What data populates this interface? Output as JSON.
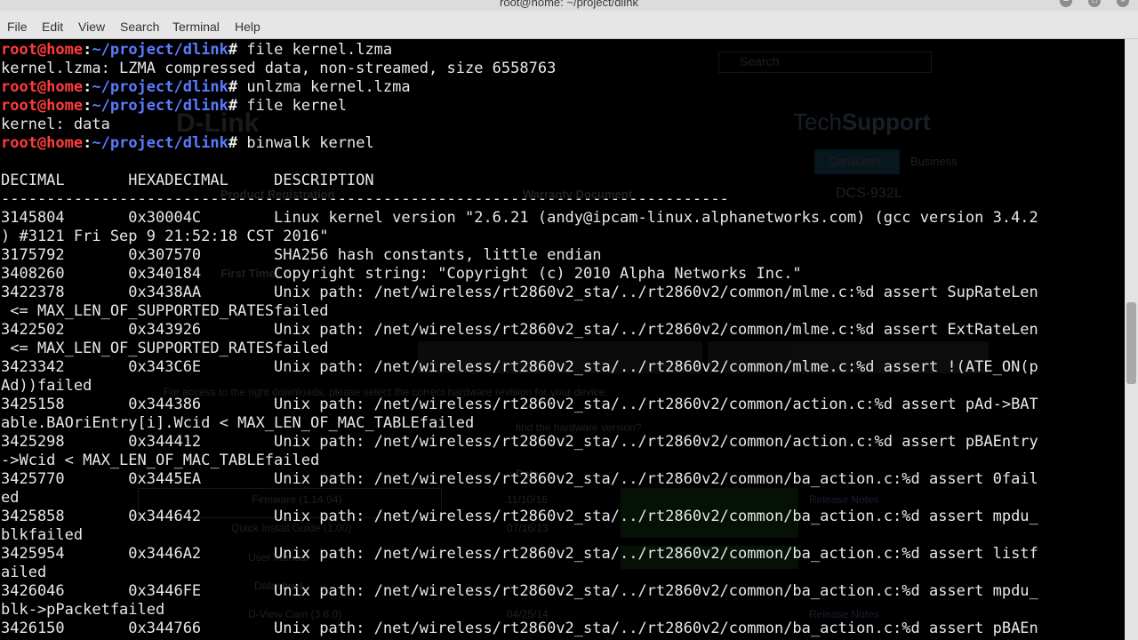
{
  "window": {
    "title": "root@home: ~/project/dlink"
  },
  "menu": [
    "File",
    "Edit",
    "View",
    "Search",
    "Terminal",
    "Help"
  ],
  "prompt": {
    "user": "root@home",
    "sep": ":",
    "path": "~/project/dlink",
    "sym": "#"
  },
  "terminal_lines": [
    {
      "type": "cmd",
      "cmd": " file kernel.lzma"
    },
    {
      "type": "out",
      "text": "kernel.lzma: LZMA compressed data, non-streamed, size 6558763"
    },
    {
      "type": "cmd",
      "cmd": " unlzma kernel.lzma"
    },
    {
      "type": "cmd",
      "cmd": " file kernel"
    },
    {
      "type": "out",
      "text": "kernel: data"
    },
    {
      "type": "cmd",
      "cmd": " binwalk kernel"
    },
    {
      "type": "out",
      "text": ""
    },
    {
      "type": "out",
      "text": "DECIMAL       HEXADECIMAL     DESCRIPTION"
    },
    {
      "type": "out",
      "text": "--------------------------------------------------------------------------------"
    },
    {
      "type": "out",
      "text": "3145804       0x30004C        Linux kernel version \"2.6.21 (andy@ipcam-linux.alphanetworks.com) (gcc version 3.4.2"
    },
    {
      "type": "out",
      "text": ") #3121 Fri Sep 9 21:52:18 CST 2016\""
    },
    {
      "type": "out",
      "text": "3175792       0x307570        SHA256 hash constants, little endian"
    },
    {
      "type": "out",
      "text": "3408260       0x340184        Copyright string: \"Copyright (c) 2010 Alpha Networks Inc.\""
    },
    {
      "type": "out",
      "text": "3422378       0x3438AA        Unix path: /net/wireless/rt2860v2_sta/../rt2860v2/common/mlme.c:%d assert SupRateLen"
    },
    {
      "type": "out",
      "text": " <= MAX_LEN_OF_SUPPORTED_RATESfailed"
    },
    {
      "type": "out",
      "text": "3422502       0x343926        Unix path: /net/wireless/rt2860v2_sta/../rt2860v2/common/mlme.c:%d assert ExtRateLen"
    },
    {
      "type": "out",
      "text": " <= MAX_LEN_OF_SUPPORTED_RATESfailed"
    },
    {
      "type": "out",
      "text": "3423342       0x343C6E        Unix path: /net/wireless/rt2860v2_sta/../rt2860v2/common/mlme.c:%d assert !(ATE_ON(p"
    },
    {
      "type": "out",
      "text": "Ad))failed"
    },
    {
      "type": "out",
      "text": "3425158       0x344386        Unix path: /net/wireless/rt2860v2_sta/../rt2860v2/common/action.c:%d assert pAd->BAT"
    },
    {
      "type": "out",
      "text": "able.BAOriEntry[i].Wcid < MAX_LEN_OF_MAC_TABLEfailed"
    },
    {
      "type": "out",
      "text": "3425298       0x344412        Unix path: /net/wireless/rt2860v2_sta/../rt2860v2/common/action.c:%d assert pBAEntry"
    },
    {
      "type": "out",
      "text": "->Wcid < MAX_LEN_OF_MAC_TABLEfailed"
    },
    {
      "type": "out",
      "text": "3425770       0x3445EA        Unix path: /net/wireless/rt2860v2_sta/../rt2860v2/common/ba_action.c:%d assert 0fail"
    },
    {
      "type": "out",
      "text": "ed"
    },
    {
      "type": "out",
      "text": "3425858       0x344642        Unix path: /net/wireless/rt2860v2_sta/../rt2860v2/common/ba_action.c:%d assert mpdu_"
    },
    {
      "type": "out",
      "text": "blkfailed"
    },
    {
      "type": "out",
      "text": "3425954       0x3446A2        Unix path: /net/wireless/rt2860v2_sta/../rt2860v2/common/ba_action.c:%d assert listf"
    },
    {
      "type": "out",
      "text": "ailed"
    },
    {
      "type": "out",
      "text": "3426046       0x3446FE        Unix path: /net/wireless/rt2860v2_sta/../rt2860v2/common/ba_action.c:%d assert mpdu_"
    },
    {
      "type": "out",
      "text": "blk->pPacketfailed"
    },
    {
      "type": "out",
      "text": "3426150       0x344766        Unix path: /net/wireless/rt2860v2_sta/../rt2860v2/common/ba_action.c:%d assert pBAEn"
    }
  ],
  "background_page": {
    "search_placeholder": "Search",
    "logo": "D-Link",
    "tech": "Tech",
    "support": "Support",
    "tab_consumer": "Consumer",
    "tab_business": "Business",
    "model": "DCS-932L",
    "product_registration": "Product Registration",
    "warranty_document": "Warranty Document",
    "first_time": "First Time",
    "downloads_note": "For access to the right downloads, please select the correct hardware revision for your device.",
    "find_revision": "find the hardware version?",
    "date_header": "Date",
    "rows": [
      {
        "name": "Firmware (1.14.04)",
        "date": "11/10/16",
        "notes": "Release Notes"
      },
      {
        "name": "Quick Install Guide (1.00)",
        "date": "07/16/13",
        "notes": ""
      },
      {
        "name": "User Manual",
        "date": "",
        "notes": ""
      },
      {
        "name": "Datasheet",
        "date": "",
        "notes": ""
      },
      {
        "name": "D-View Cam (3.6.0)",
        "date": "04/25/14",
        "notes": "Release Notes"
      }
    ]
  },
  "colors": {
    "prompt_user": "#ff3b3b",
    "prompt_path": "#5b7bff",
    "terminal_bg": "#000000",
    "terminal_fg": "#e8e8e8"
  }
}
